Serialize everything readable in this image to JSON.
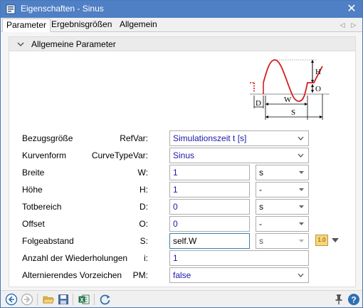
{
  "window": {
    "title": "Eigenschaften - Sinus",
    "close_glyph": "✕",
    "title_icon": "properties-window-icon"
  },
  "tabs": [
    {
      "label": "Parameter",
      "active": true
    },
    {
      "label": "Ergebnisgrößen",
      "active": false
    },
    {
      "label": "Allgemein",
      "active": false
    }
  ],
  "tab_nav": {
    "prev": "◁",
    "next": "▷"
  },
  "panel": {
    "title": "Allgemeine Parameter",
    "expand_icon": "chevron-down-icon"
  },
  "diagram_labels": {
    "H": "H",
    "O": "O",
    "D": "D",
    "W": "W",
    "S": "S"
  },
  "params": [
    {
      "label": "Bezugsgröße",
      "symbol": "RefVar:",
      "type": "select",
      "value": "Simulationszeit t [s]"
    },
    {
      "label": "Kurvenform",
      "symbol": "CurveTypeVar:",
      "type": "select",
      "value": "Sinus"
    },
    {
      "label": "Breite",
      "symbol": "W:",
      "type": "input_unit",
      "value": "1",
      "unit": "s"
    },
    {
      "label": "Höhe",
      "symbol": "H:",
      "type": "input_unit",
      "value": "1",
      "unit": "-"
    },
    {
      "label": "Totbereich",
      "symbol": "D:",
      "type": "input_unit",
      "value": "0",
      "unit": "s"
    },
    {
      "label": "Offset",
      "symbol": "O:",
      "type": "input_unit",
      "value": "0",
      "unit": "-"
    },
    {
      "label": "Folgeabstand",
      "symbol": "S:",
      "type": "input_unit_expr",
      "value": "self.W",
      "unit": "s",
      "badge": "1.0"
    },
    {
      "label": "Anzahl der Wiederholungen",
      "symbol": "i:",
      "type": "input",
      "value": "1"
    },
    {
      "label": "Alternierendes Vorzeichen",
      "symbol": "PM:",
      "type": "select",
      "value": "false"
    }
  ],
  "statusbar": {
    "icons": [
      "back-icon",
      "forward-icon",
      "open-folder-icon",
      "save-icon",
      "excel-export-icon",
      "refresh-icon",
      "pin-icon",
      "help-icon"
    ]
  },
  "colors": {
    "titlebar": "#4f7fc4",
    "accent_text": "#1a1aa8",
    "curve": "#d42020"
  }
}
